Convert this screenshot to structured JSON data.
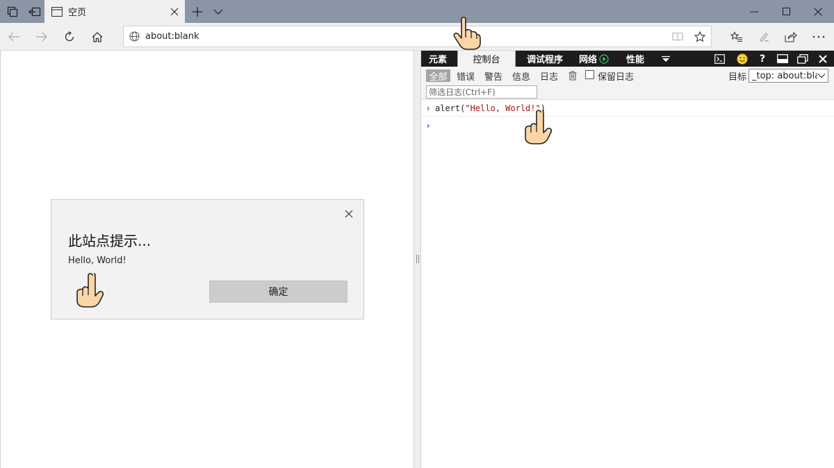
{
  "colors": {
    "titlebar": "#8a96a6",
    "devtools_bar": "#1d1d1d",
    "dialog_bg": "#f2f2f2",
    "string_red": "#a31515",
    "prompt_blue": "#1a3fd1"
  },
  "browser": {
    "tab_title": "空页",
    "address": "about:blank"
  },
  "devtools": {
    "tabs": [
      "元素",
      "控制台",
      "调试程序",
      "网络",
      "性能"
    ],
    "levels": [
      "全部",
      "错误",
      "警告",
      "信息",
      "日志"
    ],
    "preserve_log": "保留日志",
    "target_label": "目标",
    "target_value": "_top: about:blank",
    "filter_placeholder": "筛选日志(Ctrl+F)",
    "console": {
      "fn": "alert(",
      "arg": "\"Hello, World!\"",
      "close": ")"
    }
  },
  "dialog": {
    "title": "此站点提示...",
    "message": "Hello, World!",
    "ok_label": "确定"
  }
}
